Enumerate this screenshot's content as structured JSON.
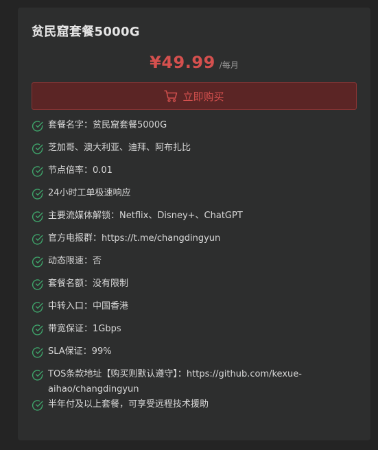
{
  "plan": {
    "title": "贫民窟套餐5000G",
    "price": "¥49.99",
    "period": "/每月",
    "buy_label": "立即购买"
  },
  "features": [
    "套餐名字：贫民窟套餐5000G",
    "芝加哥、澳大利亚、迪拜、阿布扎比",
    "节点倍率：0.01",
    "24小时工单极速响应",
    "主要流媒体解锁：Netflix、Disney+、ChatGPT",
    "官方电报群：https://t.me/changdingyun",
    "动态限速：否",
    "套餐名额：没有限制",
    "中转入口：中国香港",
    "带宽保证：1Gbps",
    "SLA保证：99%",
    "TOS条款地址【购买则默认遵守】：https://github.com/kexue-aihao/changdingyun",
    "半年付及以上套餐，可享受远程技术援助"
  ],
  "icons": {
    "check": "check-circle-icon",
    "cart": "cart-icon"
  },
  "colors": {
    "accent": "#d4504e",
    "check": "#3fa56b"
  }
}
